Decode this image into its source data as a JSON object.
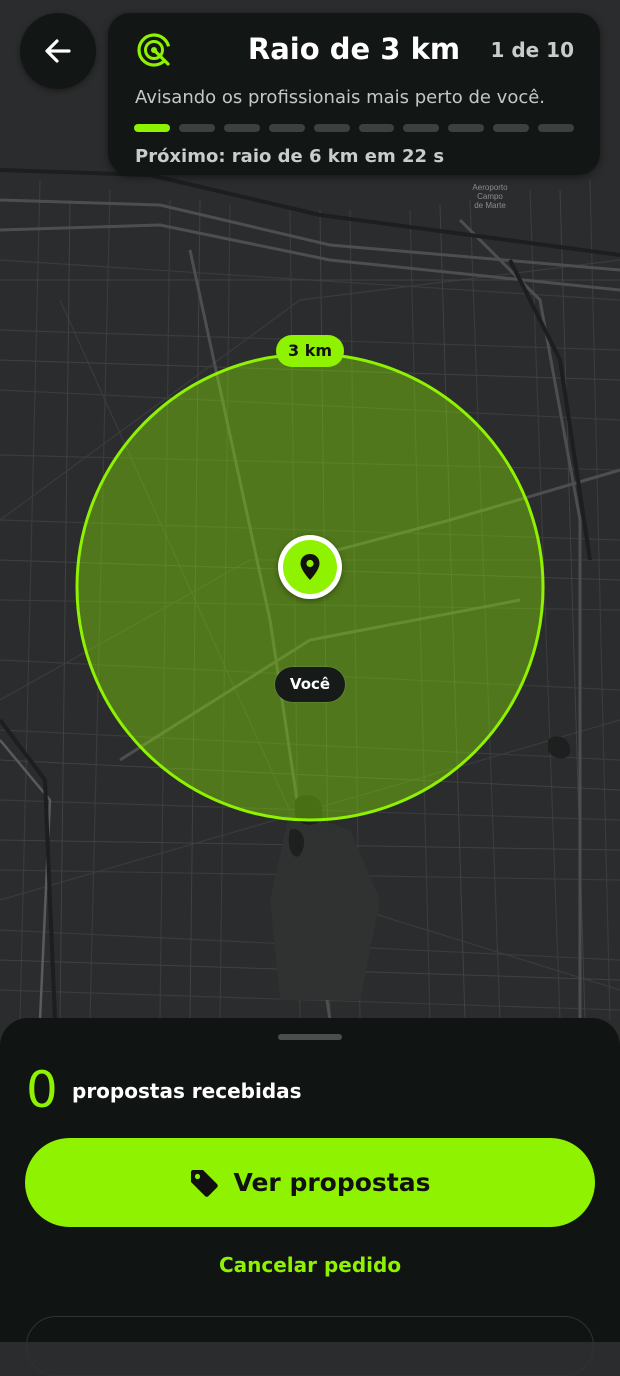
{
  "map": {
    "poi_label_lines": [
      "Aeroporto",
      "Campo",
      "de Marte"
    ],
    "radius_label": "3 km",
    "user_label": "Você",
    "accent_color": "#8ef200"
  },
  "header": {
    "back_icon": "arrow-left-icon",
    "radar_icon": "radar-icon",
    "title": "Raio de 3 km",
    "step": "1 de 10",
    "subtitle": "Avisando os profissionais mais perto de você.",
    "progress": {
      "total_steps": 10,
      "current_step": 1
    },
    "next_text": "Próximo: raio de 6 km em 22 s"
  },
  "sheet": {
    "proposals_count": "0",
    "proposals_label": "propostas recebidas",
    "primary_button": {
      "label": "Ver propostas",
      "icon": "tag-icon"
    },
    "cancel_label": "Cancelar pedido"
  }
}
